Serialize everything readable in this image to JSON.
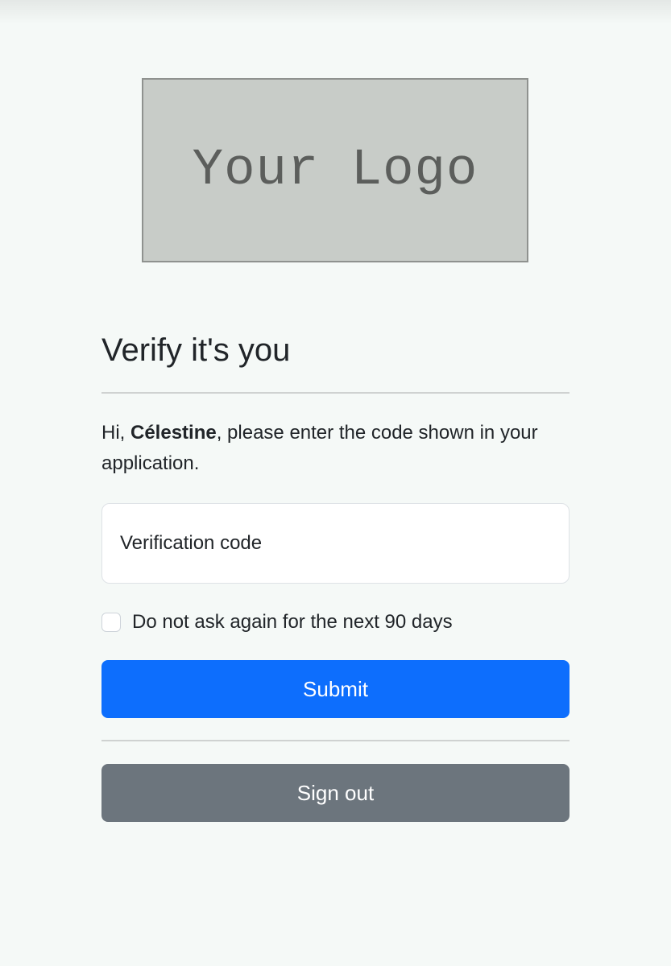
{
  "logo": {
    "text": "Your Logo"
  },
  "page": {
    "title": "Verify it's you",
    "greeting_prefix": "Hi, ",
    "user_name": "Célestine",
    "greeting_suffix": ", please enter the code shown in your application."
  },
  "form": {
    "code_placeholder": "Verification code",
    "code_value": "",
    "remember_label": "Do not ask again for the next 90 days",
    "remember_checked": false,
    "submit_label": "Submit",
    "signout_label": "Sign out"
  },
  "colors": {
    "primary": "#0d6efd",
    "secondary": "#6c757d",
    "background": "#f5f9f7",
    "logo_bg": "#c8ccc8"
  }
}
